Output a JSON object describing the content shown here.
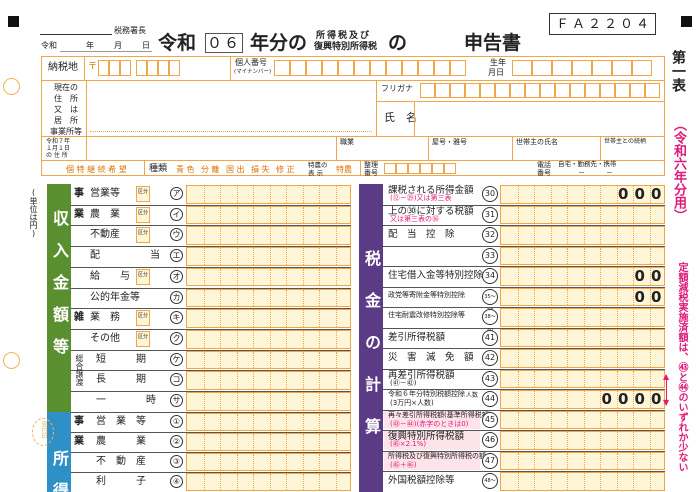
{
  "header": {
    "tax_office_suffix": "税務署長",
    "date_row": {
      "era": "令和",
      "year": "年",
      "month": "月",
      "day": "日"
    },
    "title_era": "令和",
    "year_value": "０６",
    "title_nenbun": "年分の",
    "title_tax1": "所得税及び",
    "title_tax2": "復興特別所得税",
    "title_no": "の",
    "title_report": "申告書",
    "form_code": "ＦＡ２２０４",
    "side_title": "第一表",
    "side_year": "（令和六年分用）"
  },
  "personal": {
    "address_label": "納税地",
    "postal_mark": "〒",
    "my_number_label1": "個人番号",
    "my_number_label2": "(マイナンバー)",
    "birth_label1": "生年",
    "birth_label2": "月日",
    "current_address_lines": [
      "現在の",
      "住　所",
      "又　は",
      "居　所",
      "事業所等"
    ],
    "furigana_label": "フリガナ",
    "name_label": "氏　名",
    "jan1_address_lines": [
      "令和７年",
      "１月１日",
      "の 住 所"
    ],
    "occupation_label": "職業",
    "shop_name_label": "屋号・雅号",
    "head_name_label": "世帯主の氏名",
    "head_relation_label": "世帯主との続柄",
    "special_label": "個 特 継 続 希 望",
    "type_label": "種類",
    "type_options": [
      "青 色",
      "分 離",
      "国 出",
      "損 失",
      "修 正"
    ],
    "special_table_label1": "特農の",
    "special_table_label2": "表 示",
    "tokuno_mark": "特農",
    "seiri_label1": "整理",
    "seiri_label2": "番号",
    "phone_label1": "電話",
    "phone_label2": "番号",
    "phone_types": "自宅・勤務先・携帯",
    "phone_dashes": "－　　　－"
  },
  "left_section": {
    "unit_label": "(単位は円)",
    "income_title": "収入金額等",
    "shotoku_title": "所得",
    "watermark": "受付印",
    "rows": [
      {
        "group": "事",
        "label": "営業等",
        "kubun": true,
        "num": "ア"
      },
      {
        "group": "業",
        "label": "農　業",
        "kubun": true,
        "num": "イ"
      },
      {
        "group": "",
        "label": "不動産",
        "kubun": true,
        "num": "ウ"
      },
      {
        "group": "",
        "label": "配　　　　　当",
        "kubun": false,
        "num": "エ"
      },
      {
        "group": "",
        "label": "給　　与",
        "kubun": true,
        "num": "オ"
      },
      {
        "group": "",
        "label": "公的年金等",
        "kubun": false,
        "num": "カ"
      },
      {
        "group": "雑",
        "label": "業　務",
        "kubun": true,
        "num": "キ"
      },
      {
        "group": "",
        "label": "その他",
        "kubun": true,
        "num": "ク"
      },
      {
        "group": "総合譲渡",
        "label": "短　　　期",
        "kubun": false,
        "num": "ケ"
      },
      {
        "group": "",
        "label": "長　　　期",
        "kubun": false,
        "num": "コ"
      },
      {
        "group": "",
        "label": "一　　　　時",
        "kubun": false,
        "num": "サ"
      }
    ],
    "shotoku_rows": [
      {
        "group": "事",
        "label": "営　業　等",
        "num": "①"
      },
      {
        "group": "業",
        "label": "農　　　業",
        "num": "②"
      },
      {
        "group": "",
        "label": "不　動　産",
        "num": "③"
      },
      {
        "group": "",
        "label": "利　　　子",
        "num": "④"
      }
    ],
    "kubun_label": "区分",
    "kubun_label1": "区分1",
    "kubun_label2": "区分2"
  },
  "right_section": {
    "title": "税金の計算",
    "rows": [
      {
        "label": "課税される所得金額",
        "sub": "(⑫－㉙)又は第三表",
        "num": "30",
        "zeros": "000"
      },
      {
        "label": "上の㉚に対する税額",
        "sub": "又は第三表の㊱",
        "num": "31",
        "zeros": ""
      },
      {
        "label": "配　当　控　除",
        "sub": "",
        "num": "32",
        "zeros": ""
      },
      {
        "label": "",
        "sub": "",
        "num": "33",
        "zeros": ""
      },
      {
        "label": "住宅借入金等特別控除",
        "sub": "",
        "num": "34",
        "zeros": "00"
      },
      {
        "label": "政党等寄附金等特別控除",
        "sub": "",
        "num": "35～37",
        "zeros": "00"
      },
      {
        "label": "住宅耐震改修特別控除等",
        "sub": "",
        "num": "38～40",
        "zeros": ""
      },
      {
        "label": "差引所得税額",
        "sub": "",
        "num": "41",
        "zeros": ""
      },
      {
        "label": "災　害　減　免　額",
        "sub": "",
        "num": "42",
        "zeros": ""
      },
      {
        "label": "再差引所得税額",
        "sub": "(㊶－㊷)",
        "num": "43",
        "zeros": ""
      },
      {
        "label": "令和６年分特別税額控除",
        "sub": "(3万円×人数)",
        "num": "44",
        "zeros": "0000"
      },
      {
        "label": "再々差引所得税額(基準所得税額)",
        "sub": "(㊸－㊹)(赤字のときは0)",
        "num": "45",
        "zeros": ""
      },
      {
        "label": "復興特別所得税額",
        "sub": "(㊺×2.1%)",
        "num": "46",
        "zeros": ""
      },
      {
        "label": "所得税及び復興特別所得税の額",
        "sub": "(㊺＋㊻)",
        "num": "47",
        "zeros": ""
      },
      {
        "label": "外国税額控除等",
        "sub": "",
        "num": "48～",
        "zeros": ""
      }
    ],
    "side_note": "定額減税実施済額は、㊸と㊹のいずれか少ない",
    "person_label": "人数"
  },
  "colors": {
    "orange_line": "#f0a64a",
    "green": "#5a8f2f",
    "blue": "#2f90c8",
    "purple": "#5b3a86",
    "pink": "#e0197a"
  }
}
